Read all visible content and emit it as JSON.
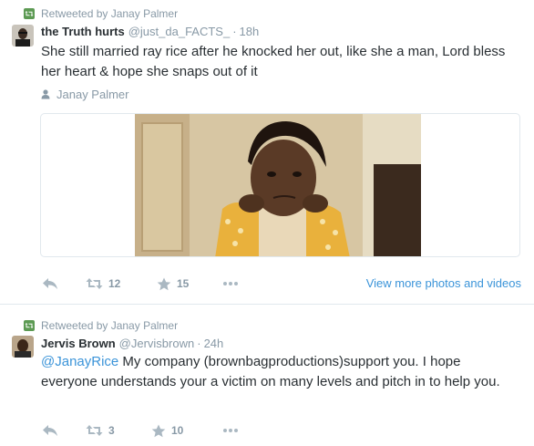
{
  "tweets": [
    {
      "context": "Retweeted by Janay Palmer",
      "fullname": "the Truth hurts",
      "username": "@just_da_FACTS_",
      "separator": "·",
      "time": "18h",
      "text": "She still married ray rice after he knocked her out, like she a man, Lord bless her heart & hope she snaps out of it",
      "tagged_user": "Janay Palmer",
      "retweets": "12",
      "favorites": "15",
      "view_more": "View more photos and videos"
    },
    {
      "context": "Retweeted by Janay Palmer",
      "fullname": "Jervis Brown",
      "username": "@Jervisbrown",
      "separator": "·",
      "time": "24h",
      "mention": "@JanayRice",
      "text": " My company (brownbagproductions)support you. I hope everyone understands your a victim on many levels and pitch in to help you.",
      "retweets": "3",
      "favorites": "10"
    }
  ],
  "colors": {
    "retweet_badge": "#5c9a53",
    "link": "#3b94d9",
    "muted": "#8899a6",
    "icon": "#aab8c2",
    "text": "#292f33"
  },
  "icons": [
    "retweet-badge-icon",
    "person-icon",
    "reply-icon",
    "retweet-icon",
    "favorite-star-icon",
    "more-dots-icon"
  ]
}
